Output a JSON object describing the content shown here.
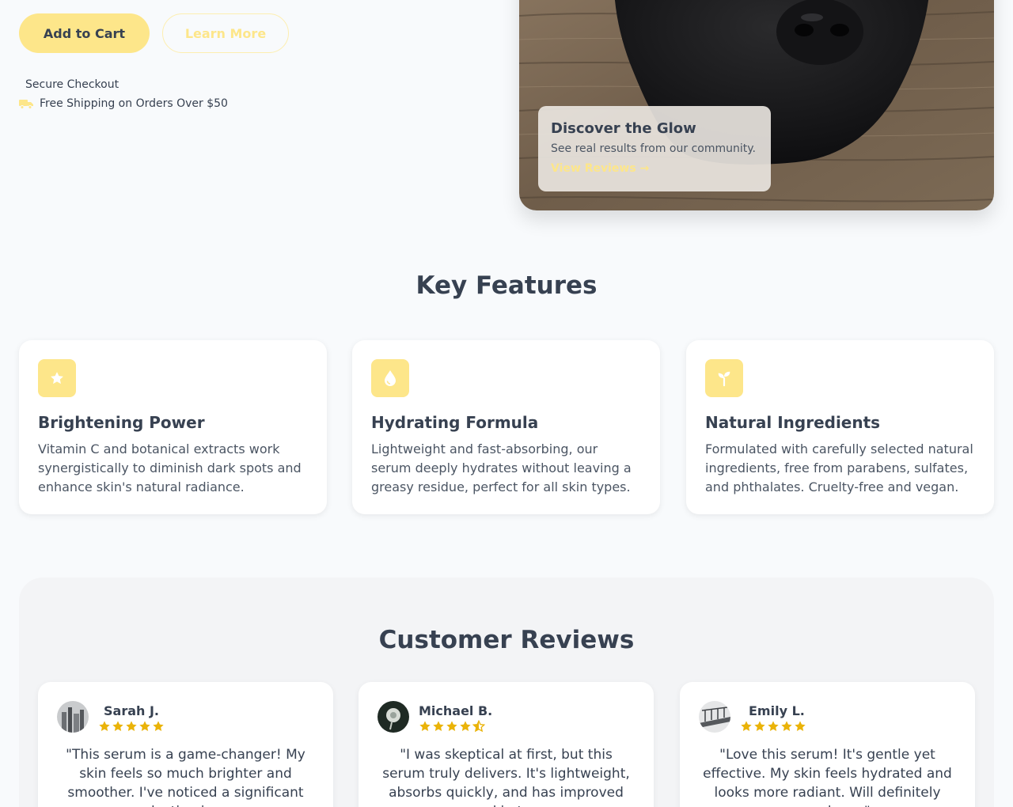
{
  "hero": {
    "add_to_cart_label": "Add to Cart",
    "learn_more_label": "Learn More",
    "perks": {
      "checkout": "Secure Checkout",
      "shipping": "Free Shipping on Orders Over $50"
    },
    "glow_card": {
      "title": "Discover the Glow",
      "subtitle": "See real results from our community.",
      "link": "View Reviews →"
    }
  },
  "features": {
    "title": "Key Features",
    "items": [
      {
        "icon": "star-icon",
        "title": "Brightening Power",
        "description": "Vitamin C and botanical extracts work synergistically to diminish dark spots and enhance skin's natural radiance."
      },
      {
        "icon": "water-drop-icon",
        "title": "Hydrating Formula",
        "description": "Lightweight and fast-absorbing, our serum deeply hydrates without leaving a greasy residue, perfect for all skin types."
      },
      {
        "icon": "seedling-icon",
        "title": "Natural Ingredients",
        "description": "Formulated with carefully selected natural ingredients, free from parabens, sulfates, and phthalates. Cruelty-free and vegan."
      }
    ]
  },
  "reviews": {
    "title": "Customer Reviews",
    "items": [
      {
        "name": "Sarah J.",
        "rating": 5,
        "text": "\"This serum is a game-changer! My skin feels so much brighter and smoother. I've noticed a significant reduction in my"
      },
      {
        "name": "Michael B.",
        "rating": 4.5,
        "text": "\"I was skeptical at first, but this serum truly delivers. It's lightweight, absorbs quickly, and has improved my skin tone."
      },
      {
        "name": "Emily L.",
        "rating": 5,
        "text": "\"Love this serum! It's gentle yet effective. My skin feels hydrated and looks more radiant. Will definitely repurchase.\""
      }
    ]
  },
  "colors": {
    "accent": "#fde68a",
    "star": "#eab308",
    "text": "#374151",
    "background": "#f8fafc"
  }
}
